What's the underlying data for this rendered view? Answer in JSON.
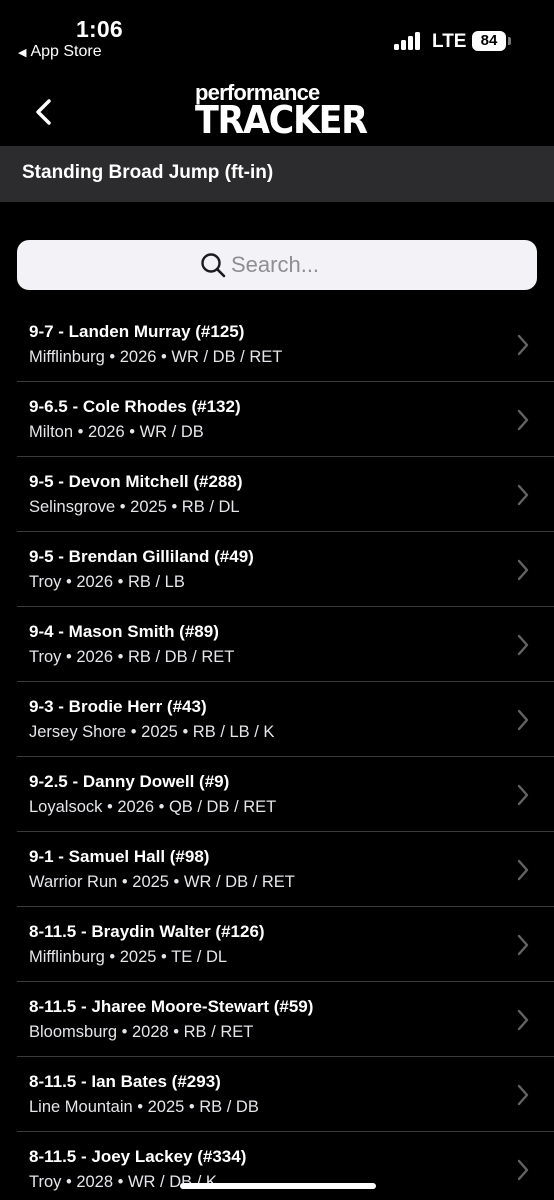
{
  "status_bar": {
    "time": "1:06",
    "back_app_label": "App Store",
    "network": "LTE",
    "battery": "84"
  },
  "header": {
    "logo_top": "performance",
    "logo_bottom": "TRACKER"
  },
  "section": {
    "title": "Standing Broad Jump (ft-in)"
  },
  "search": {
    "placeholder": "Search..."
  },
  "athletes": [
    {
      "title": "9-7 - Landen Murray (#125)",
      "subtitle": "Mifflinburg • 2026 • WR / DB / RET"
    },
    {
      "title": "9-6.5 - Cole Rhodes (#132)",
      "subtitle": "Milton • 2026 • WR / DB"
    },
    {
      "title": "9-5 - Devon Mitchell (#288)",
      "subtitle": "Selinsgrove • 2025 • RB / DL"
    },
    {
      "title": "9-5 - Brendan Gilliland (#49)",
      "subtitle": "Troy • 2026 • RB / LB"
    },
    {
      "title": "9-4 - Mason Smith (#89)",
      "subtitle": "Troy • 2026 • RB / DB / RET"
    },
    {
      "title": "9-3 - Brodie Herr (#43)",
      "subtitle": "Jersey Shore • 2025 • RB / LB / K"
    },
    {
      "title": "9-2.5 - Danny Dowell (#9)",
      "subtitle": "Loyalsock • 2026 • QB / DB / RET"
    },
    {
      "title": "9-1 - Samuel Hall (#98)",
      "subtitle": "Warrior Run • 2025 • WR / DB / RET"
    },
    {
      "title": "8-11.5 - Braydin Walter (#126)",
      "subtitle": "Mifflinburg • 2025 • TE / DL"
    },
    {
      "title": "8-11.5 - Jharee Moore-Stewart (#59)",
      "subtitle": "Bloomsburg • 2028 • RB / RET"
    },
    {
      "title": "8-11.5 - Ian Bates (#293)",
      "subtitle": "Line Mountain • 2025 • RB / DB"
    },
    {
      "title": "8-11.5 - Joey Lackey (#334)",
      "subtitle": "Troy • 2028 • WR / DB / K"
    }
  ],
  "colors": {
    "background": "#000000",
    "section_bar": "#2c2c2e",
    "search_bg": "#f2f2f7",
    "divider": "#3a3a3c",
    "chevron": "#636366"
  }
}
